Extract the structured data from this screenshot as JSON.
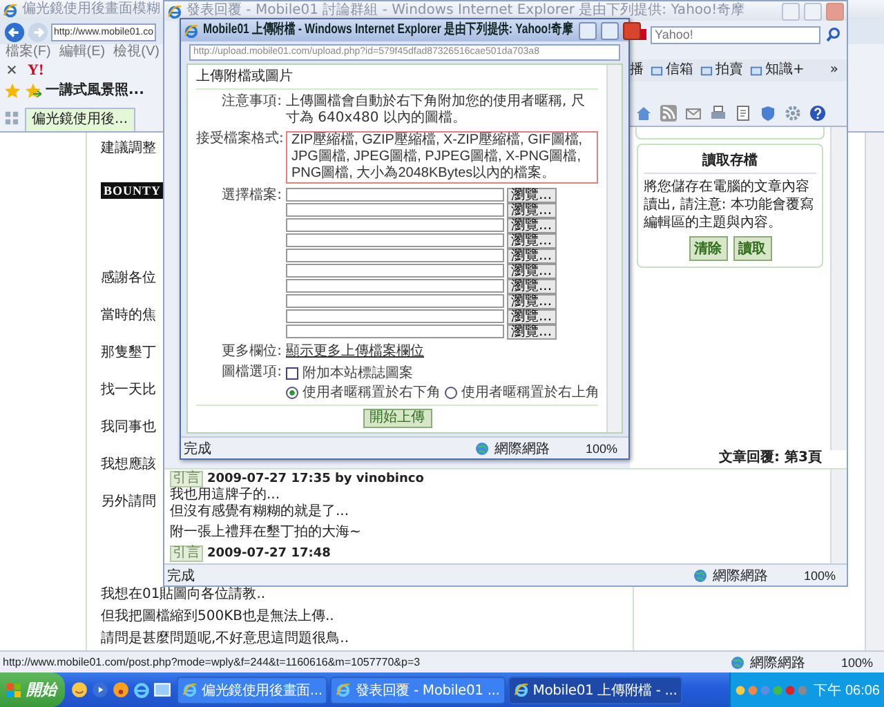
{
  "back_window": {
    "title": "偏光鏡使用後畫面模糊",
    "address": "http://www.mobile01.co",
    "menu": [
      "檔案(F)",
      "編輯(E)",
      "檢視(V)"
    ],
    "yahoo_logo": "Y!",
    "favorite": "一講式風景照...",
    "tab": {
      "label": "偏光鏡使用後...",
      "selected": true
    },
    "intro_line": "建議調整",
    "banner": "BOUNTY",
    "partial_lines": [
      "感謝各位",
      "當時的焦",
      "那隻墾丁",
      "找一天比",
      "我同事也",
      "我想應該",
      "另外請問"
    ],
    "lines": [
      "我想在01貼圖向各位請教..",
      "但我把圖檔縮到500KB也是無法上傳..",
      "請問是甚麼問題呢,不好意思這問題很鳥.."
    ],
    "status_bar": {
      "url": "http://www.mobile01.com/post.php?mode=wply&f=244&t=1160616&m=1057770&p=3",
      "zone": "網際網路",
      "zoom": "100%"
    }
  },
  "middle_window": {
    "title": "發表回覆 - Mobile01 討論群組 - Windows Internet Explorer 是由下列提供: Yahoo!奇摩",
    "search": {
      "placeholder": "Yahoo!"
    },
    "toolbar": [
      "播",
      "信箱",
      "拍賣",
      "知識+"
    ],
    "toolbar_more": "»",
    "load_panel": {
      "title": "讀取存檔",
      "text": "將您儲存在電腦的文章內容讀出, 請注意: 本功能會覆寫編輯區的主題與內容。",
      "buttons": [
        "清除",
        "讀取"
      ]
    },
    "page_label": "文章回覆: 第3頁",
    "replies": [
      {
        "quote": "引言",
        "header": "2009-07-27 17:35 by vinobinco",
        "lines": [
          "我也用這牌子的...",
          "但沒有感覺有糊糊的就是了...",
          "附一張上禮拜在墾丁拍的大海~"
        ]
      },
      {
        "quote": "引言",
        "header": "2009-07-27 17:48"
      }
    ],
    "status_bar": {
      "text": "完成",
      "zone": "網際網路",
      "zoom": "100%"
    }
  },
  "popup": {
    "title": "Mobile01 上傳附檔 - Windows Internet Explorer 是由下列提供: Yahoo!奇摩",
    "address": "http://upload.mobile01.com/upload.php?id=579f45dfad87326516cae501da703a8",
    "heading": "上傳附檔或圖片",
    "notice": {
      "label": "注意事項:",
      "text": "上傳圖檔會自動於右下角附加您的使用者暱稱, 尺寸為 640x480 以內的圖檔。"
    },
    "formats": {
      "label": "接受檔案格式:",
      "text": "ZIP壓縮檔, GZIP壓縮檔, X-ZIP壓縮檔, GIF圖檔, JPG圖檔, JPEG圖檔, PJPEG圖檔, X-PNG圖檔, PNG圖檔, 大小為2048KBytes以內的檔案。"
    },
    "file_label": "選擇檔案:",
    "files": [
      "瀏覽...",
      "瀏覽...",
      "瀏覽...",
      "瀏覽...",
      "瀏覽...",
      "瀏覽...",
      "瀏覽...",
      "瀏覽...",
      "瀏覽...",
      "瀏覽..."
    ],
    "more": {
      "label": "更多欄位:",
      "link": "顯示更多上傳檔案欄位"
    },
    "options": {
      "label": "圖檔選項:",
      "checkbox": {
        "label": "附加本站標誌圖案",
        "checked": false
      },
      "radios": [
        {
          "label": "使用者暱稱置於右下角",
          "selected": true
        },
        {
          "label": "使用者暱稱置於右上角",
          "selected": false
        }
      ]
    },
    "submit": "開始上傳",
    "status_bar": {
      "text": "完成",
      "zone": "網際網路",
      "zoom": "100%"
    }
  },
  "taskbar": {
    "start": "開始",
    "tasks": [
      {
        "label": "偏光鏡使用後畫面...",
        "selected": false
      },
      {
        "label": "發表回覆 - Mobile01 ...",
        "selected": false
      },
      {
        "label": "Mobile01 上傳附檔 - ...",
        "selected": true
      }
    ],
    "clock": "下午 06:06"
  }
}
